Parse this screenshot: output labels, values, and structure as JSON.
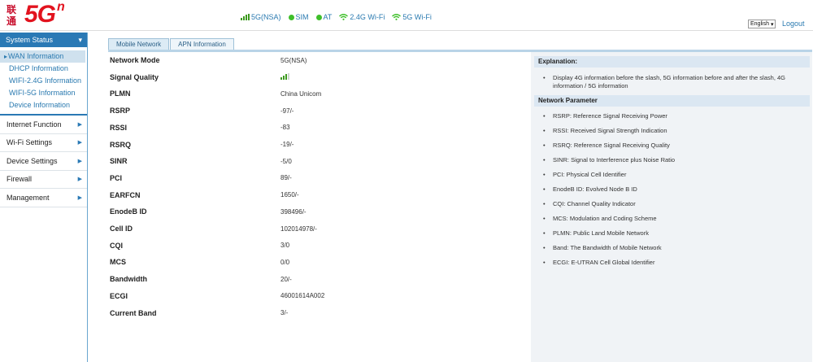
{
  "header": {
    "logo_cjk": "联通",
    "logo_main": "5G",
    "logo_sup": "n",
    "status": [
      {
        "icon": "signal-bars-icon",
        "label": "5G(NSA)"
      },
      {
        "icon": "sim-status-dot-icon",
        "label": "SIM"
      },
      {
        "icon": "at-status-dot-icon",
        "label": "AT"
      },
      {
        "icon": "wifi-icon",
        "label": "2.4G Wi-Fi"
      },
      {
        "icon": "wifi-icon",
        "label": "5G Wi-Fi"
      }
    ],
    "language": "English",
    "logout": "Logout",
    "status_color": "#3fbf2a"
  },
  "sidebar": {
    "head": "System Status",
    "sub_items": [
      {
        "label": "WAN Information",
        "active": true
      },
      {
        "label": "DHCP Information",
        "active": false
      },
      {
        "label": "WIFI-2.4G Information",
        "active": false
      },
      {
        "label": "WIFI-5G Information",
        "active": false
      },
      {
        "label": "Device Information",
        "active": false
      }
    ],
    "sections": [
      "Internet Function",
      "Wi-Fi Settings",
      "Device Settings",
      "Firewall",
      "Management"
    ]
  },
  "tabs": [
    {
      "label": "Mobile Network",
      "active": true
    },
    {
      "label": "APN Information",
      "active": false
    }
  ],
  "params": [
    {
      "key": "Network Mode",
      "value": "5G(NSA)"
    },
    {
      "key": "Signal Quality",
      "value": "",
      "signal_level": 3,
      "signal_max": 5
    },
    {
      "key": "PLMN",
      "value": "China Unicom"
    },
    {
      "key": "RSRP",
      "value": "-97/-"
    },
    {
      "key": "RSSI",
      "value": "-83"
    },
    {
      "key": "RSRQ",
      "value": "-19/-"
    },
    {
      "key": "SINR",
      "value": "-5/0"
    },
    {
      "key": "PCI",
      "value": "89/-"
    },
    {
      "key": "EARFCN",
      "value": "1650/-"
    },
    {
      "key": "EnodeB ID",
      "value": "398496/-"
    },
    {
      "key": "Cell ID",
      "value": "102014978/-"
    },
    {
      "key": "CQI",
      "value": "3/0"
    },
    {
      "key": "MCS",
      "value": "0/0"
    },
    {
      "key": "Bandwidth",
      "value": "20/-"
    },
    {
      "key": "ECGI",
      "value": "46001614A002"
    },
    {
      "key": "Current Band",
      "value": "3/-"
    }
  ],
  "explanation": {
    "title": "Explanation:",
    "text": "Display 4G information before the slash, 5G information before and after the slash, 4G information / 5G information"
  },
  "network_parameter": {
    "title": "Network Parameter",
    "items": [
      "RSRP: Reference Signal Receiving Power",
      "RSSI: Received Signal Strength Indication",
      "RSRQ: Reference Signal Receiving Quality",
      "SINR: Signal to Interference plus Noise Ratio",
      "PCI: Physical Cell Identifier",
      "EnodeB ID: Evolved Node B ID",
      "CQI: Channel Quality Indicator",
      "MCS: Modulation and Coding Scheme",
      "PLMN: Public Land Mobile Network",
      "Band: The Bandwidth of Mobile Network",
      "ECGI: E-UTRAN Cell Global Identifier"
    ]
  }
}
